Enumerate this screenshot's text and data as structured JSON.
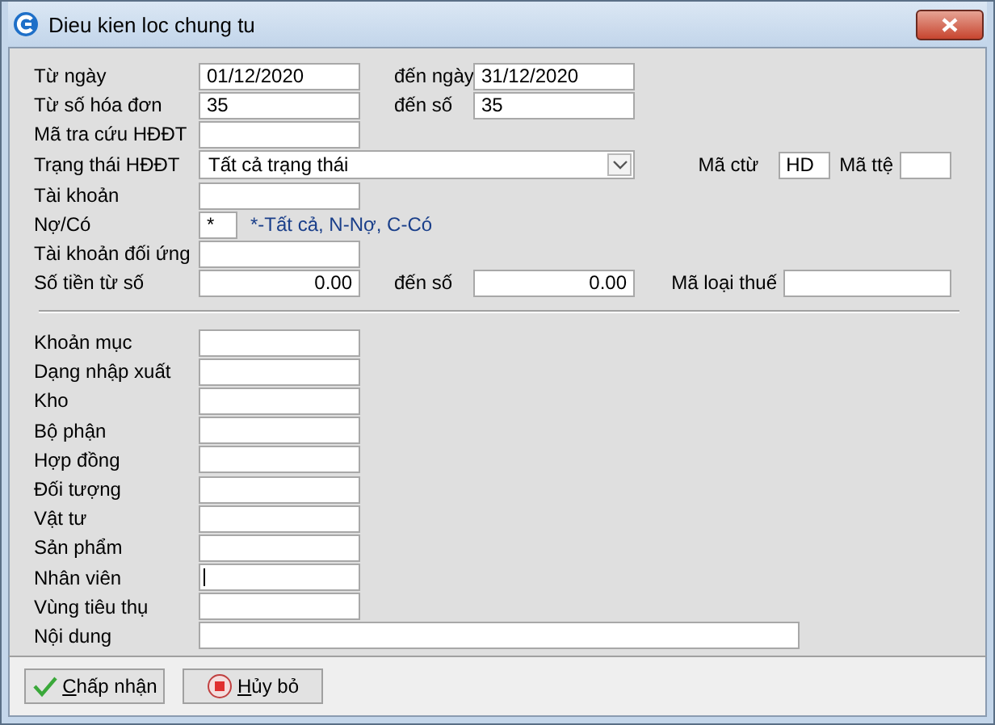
{
  "window": {
    "title": "Dieu kien loc chung tu"
  },
  "top_rows": [
    {
      "kind": "range",
      "label": "Từ ngày",
      "value": "01/12/2020",
      "to_label": "đến ngày",
      "to_value": "31/12/2020"
    },
    {
      "kind": "range",
      "label": "Từ số hóa đơn",
      "value": "35",
      "to_label": "đến số",
      "to_value": "35"
    },
    {
      "kind": "text",
      "label": "Mã tra cứu HĐĐT"
    },
    {
      "kind": "dropdown",
      "label": "Trạng thái HĐĐT",
      "value": "Tất cả trạng thái",
      "extras": [
        {
          "label": "Mã ctừ",
          "value": "HD"
        },
        {
          "label": "Mã ttệ"
        }
      ]
    },
    {
      "kind": "text",
      "label": "Tài khoản"
    },
    {
      "kind": "hint",
      "label": "Nợ/Có",
      "value": "*",
      "hint": "*-Tất cả, N-Nợ, C-Có"
    },
    {
      "kind": "text",
      "label": "Tài khoản đối ứng"
    },
    {
      "kind": "amount",
      "label": "Số tiền từ số",
      "value": "0.00",
      "to_label": "đến số",
      "to_value": "0.00",
      "extras": [
        {
          "label": "Mã loại thuế",
          "kind": "long"
        }
      ]
    }
  ],
  "bottom_rows": [
    {
      "label": "Khoản mục",
      "focused": false,
      "kind": "text"
    },
    {
      "label": "Dạng nhập xuất",
      "focused": false,
      "kind": "text"
    },
    {
      "label": "Kho",
      "focused": false,
      "kind": "text"
    },
    {
      "label": "Bộ phận",
      "focused": false,
      "kind": "text"
    },
    {
      "label": "Hợp đồng",
      "focused": false,
      "kind": "text"
    },
    {
      "label": "Đối tượng",
      "focused": false,
      "kind": "text"
    },
    {
      "label": "Vật tư",
      "focused": false,
      "kind": "text"
    },
    {
      "label": "Sản phẩm",
      "focused": false,
      "kind": "text"
    },
    {
      "label": "Nhân viên",
      "focused": true,
      "kind": "text"
    },
    {
      "label": "Vùng tiêu thụ",
      "focused": false,
      "kind": "text"
    },
    {
      "label": "Nội dung",
      "focused": false,
      "kind": "wide"
    }
  ],
  "buttons": [
    {
      "kind": "accept",
      "label": "Chấp nhận"
    },
    {
      "kind": "cancel",
      "label": "Hủy bỏ"
    }
  ]
}
